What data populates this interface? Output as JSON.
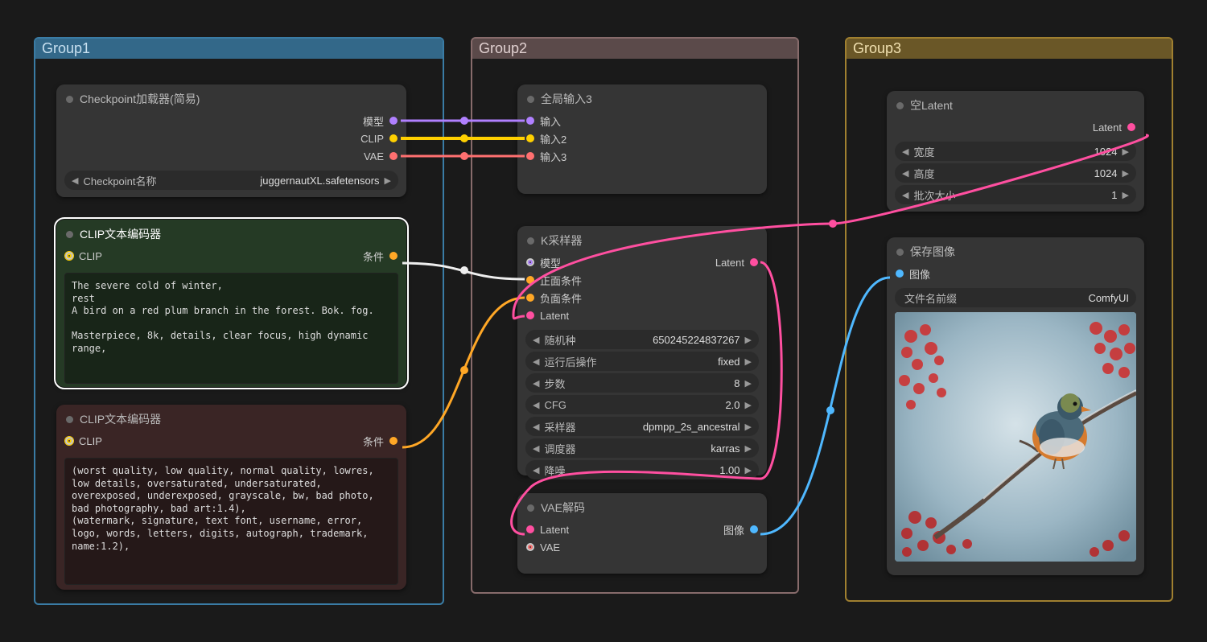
{
  "groups": {
    "g1": {
      "title": "Group1"
    },
    "g2": {
      "title": "Group2"
    },
    "g3": {
      "title": "Group3"
    }
  },
  "nodes": {
    "checkpoint": {
      "title": "Checkpoint加载器(简易)",
      "outputs": {
        "model": "模型",
        "clip": "CLIP",
        "vae": "VAE"
      },
      "widget": {
        "label": "Checkpoint名称",
        "value": "juggernautXL.safetensors"
      }
    },
    "clip_pos": {
      "title": "CLIP文本编码器",
      "input": "CLIP",
      "output": "条件",
      "text": "The severe cold of winter,\nrest\nA bird on a red plum branch in the forest. Bok. fog.\n\nMasterpiece, 8k, details, clear focus, high dynamic range,"
    },
    "clip_neg": {
      "title": "CLIP文本编码器",
      "input": "CLIP",
      "output": "条件",
      "text": "(worst quality, low quality, normal quality, lowres, low details, oversaturated, undersaturated, overexposed, underexposed, grayscale, bw, bad photo, bad photography, bad art:1.4),\n(watermark, signature, text font, username, error, logo, words, letters, digits, autograph, trademark, name:1.2),"
    },
    "global_in": {
      "title": "全局输入3",
      "inputs": [
        "输入",
        "输入2",
        "输入3"
      ]
    },
    "ksampler": {
      "title": "K采样器",
      "inputs": {
        "model": "模型",
        "positive": "正面条件",
        "negative": "负面条件",
        "latent": "Latent"
      },
      "output": "Latent",
      "widgets": {
        "seed": {
          "label": "随机种",
          "value": "650245224837267"
        },
        "after": {
          "label": "运行后操作",
          "value": "fixed"
        },
        "steps": {
          "label": "步数",
          "value": "8"
        },
        "cfg": {
          "label": "CFG",
          "value": "2.0"
        },
        "sampler": {
          "label": "采样器",
          "value": "dpmpp_2s_ancestral"
        },
        "scheduler": {
          "label": "调度器",
          "value": "karras"
        },
        "denoise": {
          "label": "降噪",
          "value": "1.00"
        }
      }
    },
    "vae_decode": {
      "title": "VAE解码",
      "inputs": {
        "latent": "Latent",
        "vae": "VAE"
      },
      "output": "图像"
    },
    "empty_latent": {
      "title": "空Latent",
      "output": "Latent",
      "widgets": {
        "width": {
          "label": "宽度",
          "value": "1024"
        },
        "height": {
          "label": "高度",
          "value": "1024"
        },
        "batch": {
          "label": "批次大小",
          "value": "1"
        }
      }
    },
    "save_image": {
      "title": "保存图像",
      "input": "图像",
      "widget": {
        "label": "文件名前缀",
        "value": "ComfyUI"
      }
    }
  }
}
